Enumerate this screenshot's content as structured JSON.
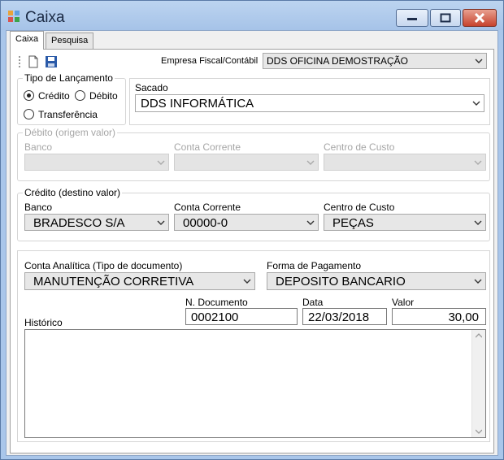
{
  "window": {
    "title": "Caixa"
  },
  "tabs": [
    {
      "label": "Caixa"
    },
    {
      "label": "Pesquisa"
    }
  ],
  "toolbar": {
    "new_icon": "new-document-icon",
    "save_icon": "floppy-save-icon",
    "empresa_label": "Empresa Fiscal/Contábil",
    "empresa_value": "DDS OFICINA DEMOSTRAÇÃO"
  },
  "tipo_lancamento": {
    "title": "Tipo de Lançamento",
    "options": [
      {
        "label": "Crédito",
        "selected": true
      },
      {
        "label": "Débito",
        "selected": false
      },
      {
        "label": "Transferência",
        "selected": false
      }
    ]
  },
  "sacado": {
    "label": "Sacado",
    "value": "DDS INFORMÁTICA"
  },
  "debito": {
    "title": "Débito (origem valor)",
    "banco_label": "Banco",
    "conta_label": "Conta Corrente",
    "centro_label": "Centro de Custo"
  },
  "credito": {
    "title": "Crédito (destino valor)",
    "banco_label": "Banco",
    "banco_value": "BRADESCO S/A",
    "conta_label": "Conta Corrente",
    "conta_value": "00000-0",
    "centro_label": "Centro de Custo",
    "centro_value": "PEÇAS"
  },
  "documento": {
    "conta_analitica_label": "Conta Analítica (Tipo de documento)",
    "conta_analitica_value": "MANUTENÇÃO CORRETIVA",
    "forma_pagamento_label": "Forma de Pagamento",
    "forma_pagamento_value": "DEPOSITO BANCARIO",
    "n_documento_label": "N. Documento",
    "n_documento_value": "0002100",
    "data_label": "Data",
    "data_value": "22/03/2018",
    "valor_label": "Valor",
    "valor_value": "30,00",
    "historico_label": "Histórico",
    "historico_value": ""
  }
}
